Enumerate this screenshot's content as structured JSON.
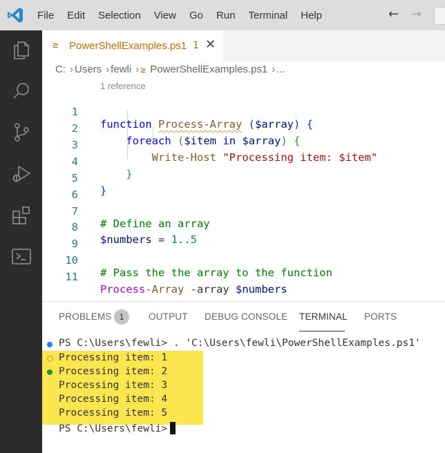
{
  "menu": {
    "items": [
      "File",
      "Edit",
      "Selection",
      "View",
      "Go",
      "Run",
      "Terminal",
      "Help"
    ],
    "back_icon": "arrow-left-icon",
    "forward_icon": "arrow-right-icon"
  },
  "activity_bar": {
    "icons": [
      "explorer-icon",
      "search-icon",
      "source-control-icon",
      "run-debug-icon",
      "extensions-icon",
      "powershell-terminal-icon"
    ]
  },
  "tab": {
    "icon": "powershell-icon",
    "prompt_glyph": "≥",
    "name": "PowerShellExamples.ps1",
    "problem_count": "1",
    "close_glyph": "✕"
  },
  "breadcrumb": {
    "drive": "C:",
    "folder1": "Users",
    "folder2": "fewli",
    "file": "PowerShellExamples.ps1",
    "ellipsis": "..."
  },
  "editor": {
    "codelens": "1 reference",
    "line_numbers": [
      "1",
      "2",
      "3",
      "4",
      "5",
      "6",
      "7",
      "8",
      "9",
      "10",
      "11"
    ],
    "l1": {
      "kw": "function",
      "name": "Process-Array",
      "param": "$array",
      "brace": "{"
    },
    "l2": {
      "kw": "foreach",
      "open": "(",
      "var": "$item",
      "in": "in",
      "arr": "$array",
      "close": ")",
      "brace": "{"
    },
    "l3": {
      "cmd": "Write-Host",
      "str": "\"Processing item: $item\""
    },
    "l4": {
      "brace": "}"
    },
    "l5": {
      "brace": "}"
    },
    "l7": {
      "comment": "# Define an array"
    },
    "l8": {
      "var": "$numbers",
      "eq": "=",
      "range": "1..5"
    },
    "l10": {
      "comment": "# Pass the the array to the function"
    },
    "l11": {
      "fn_a": "Process",
      "fn_b": "-Array",
      "param": "-array",
      "var": "$numbers"
    }
  },
  "panel": {
    "tabs": {
      "problems": "PROBLEMS",
      "problems_badge": "1",
      "output": "OUTPUT",
      "debug_console": "DEBUG CONSOLE",
      "terminal": "TERMINAL",
      "ports": "PORTS"
    },
    "active_tab": "TERMINAL"
  },
  "terminal": {
    "command_line": "PS C:\\Users\\fewli> . 'C:\\Users\\fewli\\PowerShellExamples.ps1'",
    "output": [
      "Processing item: 1",
      "Processing item: 2",
      "Processing item: 3",
      "Processing item: 4",
      "Processing item: 5"
    ],
    "prompt": "PS C:\\Users\\fewli>",
    "highlight_color": "#fbe64f"
  },
  "colors": {
    "activity_bar": "#2c2c2c",
    "title_bar": "#dddddd",
    "powershell_accent": "#c56a00",
    "vscode_blue": "#2489ca"
  }
}
